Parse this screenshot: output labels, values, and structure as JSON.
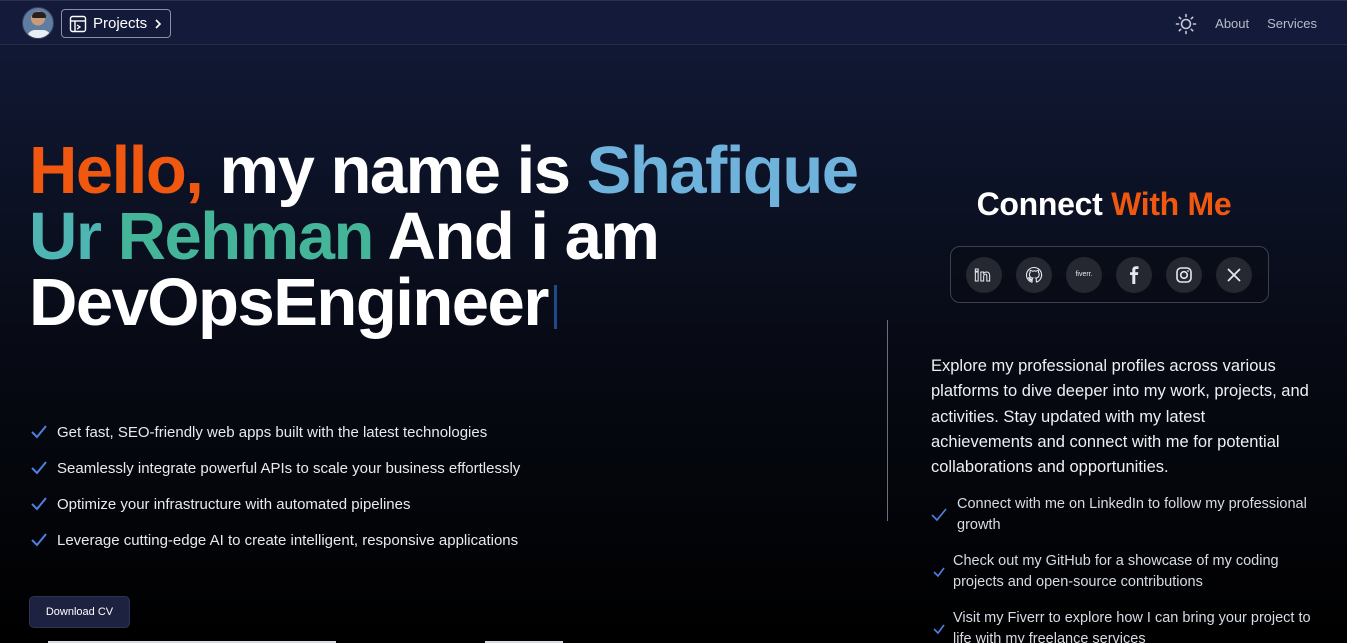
{
  "header": {
    "projects_label": "Projects",
    "nav": [
      "About",
      "Services"
    ]
  },
  "hero": {
    "part_hello": "Hello,",
    "part_myname": " my name is ",
    "part_first": "Shafique",
    "part_ur": "Ur ",
    "part_rehman": "Rehman",
    "part_andiam": " And i am",
    "role": "DevOpsEngineer"
  },
  "features": [
    "Get fast, SEO-friendly web apps built with the latest technologies",
    "Seamlessly integrate powerful APIs to scale your business effortlessly",
    "Optimize your infrastructure with automated pipelines",
    "Leverage cutting-edge AI to create intelligent, responsive applications"
  ],
  "download_label": "Download CV",
  "connect": {
    "title_part1": "Connect ",
    "title_part2": "With Me",
    "socials": [
      "linkedin-icon",
      "github-icon",
      "fiverr-icon",
      "facebook-icon",
      "instagram-icon",
      "x-icon"
    ],
    "fiverr_text": "fiverr.",
    "intro": "Explore my professional profiles across various platforms to dive deeper into my work, projects, and activities. Stay updated with my latest achievements and connect with me for potential collaborations and opportunities.",
    "items": [
      "Connect with me on LinkedIn to follow my professional growth",
      "Check out my GitHub for a showcase of my coding projects and open-source contributions",
      "Visit my Fiverr to explore how I can bring your project to life with my freelance services"
    ]
  },
  "colors": {
    "accent_orange": "#f0570f",
    "accent_blue": "#6fb3dc",
    "accent_teal": "#4fb5b3",
    "check_blue": "#4f7fe0"
  }
}
